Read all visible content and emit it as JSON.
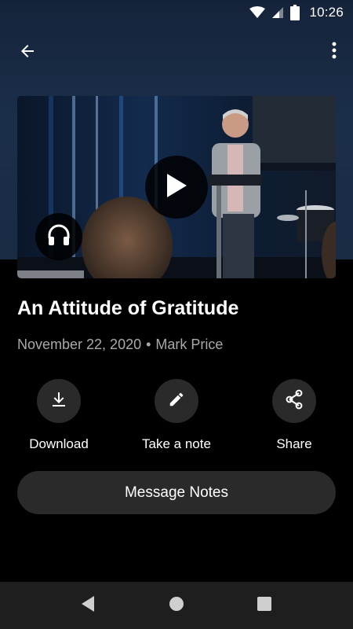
{
  "status_bar": {
    "time": "10:26",
    "icons": [
      "wifi-icon",
      "cell-signal-icon",
      "battery-icon"
    ]
  },
  "app_bar": {
    "back_icon": "arrow-left-icon",
    "menu_icon": "more-vertical-icon"
  },
  "media": {
    "play_icon": "play-icon",
    "audio_icon": "headphones-icon"
  },
  "message": {
    "title": "An Attitude of Gratitude",
    "date": "November 22, 2020",
    "separator": "•",
    "speaker": "Mark Price"
  },
  "actions": [
    {
      "label": "Download",
      "icon": "download-icon"
    },
    {
      "label": "Take a note",
      "icon": "pencil-icon"
    },
    {
      "label": "Share",
      "icon": "share-icon"
    }
  ],
  "notes_button": {
    "label": "Message Notes"
  },
  "nav_bar": {
    "icons": [
      "nav-back-icon",
      "nav-home-icon",
      "nav-recent-icon"
    ]
  },
  "colors": {
    "background": "#000000",
    "header_gradient": "#1b2e49",
    "button_fill": "#2a2a2a",
    "meta_text": "#a9a9a9",
    "nav_bar": "#1e1e1e"
  }
}
